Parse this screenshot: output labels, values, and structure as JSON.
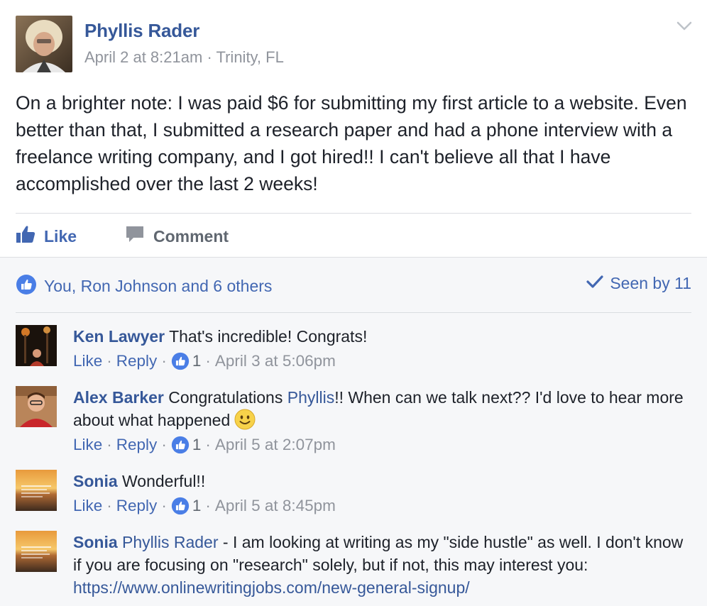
{
  "post": {
    "author": "Phyllis Rader",
    "timestamp": "April 2 at 8:21am",
    "separator": "·",
    "location": "Trinity, FL",
    "text": "On a brighter note: I was paid $6 for submitting my first article to a website. Even better than that, I submitted a research paper and had a phone interview with a freelance writing company, and I got hired!! I can't believe all that I have accomplished over the last 2 weeks!"
  },
  "actions": {
    "like_label": "Like",
    "comment_label": "Comment"
  },
  "reactions": {
    "summary": "You, Ron Johnson and 6 others",
    "seen": "Seen by 11"
  },
  "comments": [
    {
      "name": "Ken Lawyer",
      "text": "That's incredible! Congrats!",
      "like": "Like",
      "reply": "Reply",
      "likes": "1",
      "time": "April 3 at 5:06pm"
    },
    {
      "name": "Alex Barker",
      "text_before": "Congratulations ",
      "mention": "Phyllis",
      "text_after": "!! When can we talk next?? I'd love to hear more about what happened",
      "emoji": "smiley-emoji",
      "like": "Like",
      "reply": "Reply",
      "likes": "1",
      "time": "April 5 at 2:07pm"
    },
    {
      "name": "Sonia",
      "text": "Wonderful!!",
      "like": "Like",
      "reply": "Reply",
      "likes": "1",
      "time": "April 5 at 8:45pm"
    },
    {
      "name": "Sonia",
      "mention": "Phyllis Rader",
      "text": " - I am looking at writing as my \"side hustle\" as well. I don't know if you are focusing on \"research\" solely, but if not, this may interest you:",
      "link": "https://www.onlinewritingjobs.com/new-general-signup/"
    }
  ],
  "icons": {
    "chevron": "chevron-down-icon",
    "like": "thumbs-up-icon",
    "comment": "speech-bubble-icon",
    "reaction": "like-reaction-icon",
    "seen": "checkmark-icon"
  },
  "colors": {
    "link_blue": "#365899",
    "action_blue": "#4267b2",
    "meta_gray": "#90949c",
    "bottom_bg": "#f6f7f9"
  }
}
